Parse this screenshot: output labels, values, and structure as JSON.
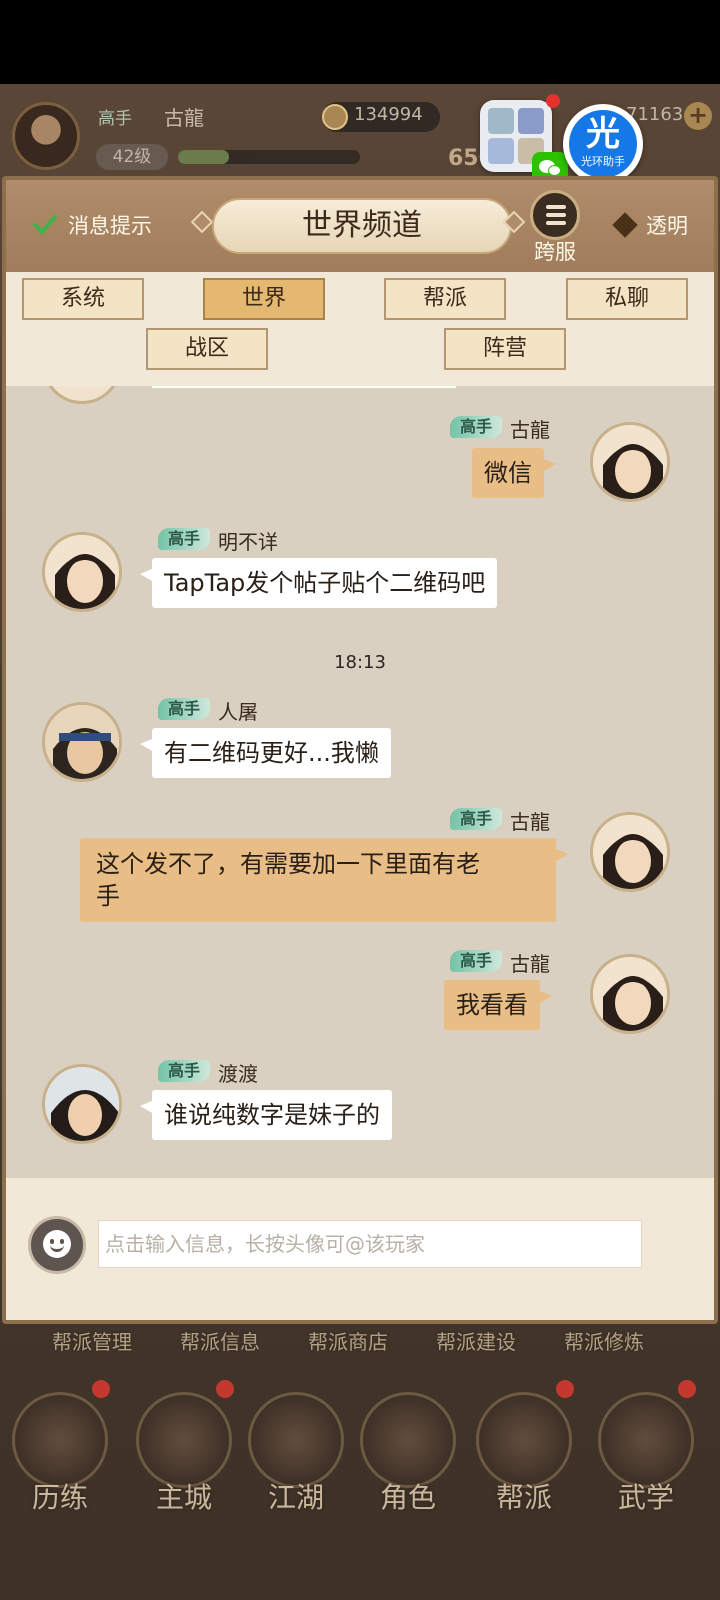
{
  "hud": {
    "rank": "高手",
    "player_name": "古龍",
    "level": "42级",
    "coins": "134994",
    "gold": "71163",
    "power_partial": "650",
    "exp_progress": 0.28
  },
  "overlay": {
    "halo_char": "光",
    "halo_label": "光环助手"
  },
  "panel": {
    "message_tip": "消息提示",
    "title": "世界频道",
    "cross_server": "跨服",
    "transparent": "透明"
  },
  "tabs": [
    {
      "label": "系统",
      "active": false
    },
    {
      "label": "世界",
      "active": true
    },
    {
      "label": "帮派",
      "active": false
    },
    {
      "label": "私聊",
      "active": false
    },
    {
      "label": "战区",
      "active": false
    },
    {
      "label": "阵营",
      "active": false
    }
  ],
  "messages": [
    {
      "rank": "高手",
      "sender": "古龍",
      "text": "微信",
      "self": true
    },
    {
      "rank": "高手",
      "sender": "明不详",
      "text": "TapTap发个帖子贴个二维码吧",
      "self": false
    },
    {
      "timestamp": "18:13"
    },
    {
      "rank": "高手",
      "sender": "人屠",
      "text": "有二维码更好...我懒",
      "self": false
    },
    {
      "rank": "高手",
      "sender": "古龍",
      "text": "这个发不了，有需要加一下里面有老手",
      "line1": "这个发不了，有需要加一下里面有老",
      "line2": "手",
      "self": true
    },
    {
      "rank": "高手",
      "sender": "古龍",
      "text": "我看看",
      "self": true
    },
    {
      "rank": "高手",
      "sender": "渡渡",
      "text": "谁说纯数字是妹子的",
      "self": false
    }
  ],
  "input": {
    "placeholder": "点击输入信息，长按头像可@该玩家"
  },
  "guild_menu": [
    "帮派管理",
    "帮派信息",
    "帮派商店",
    "帮派建设",
    "帮派修炼"
  ],
  "nav": [
    "历练",
    "主城",
    "江湖",
    "角色",
    "帮派",
    "武学"
  ],
  "colors": {
    "accent_orange": "#e8bd86",
    "active_tab": "#e4b870",
    "rank_badge": "#74c3a6"
  }
}
